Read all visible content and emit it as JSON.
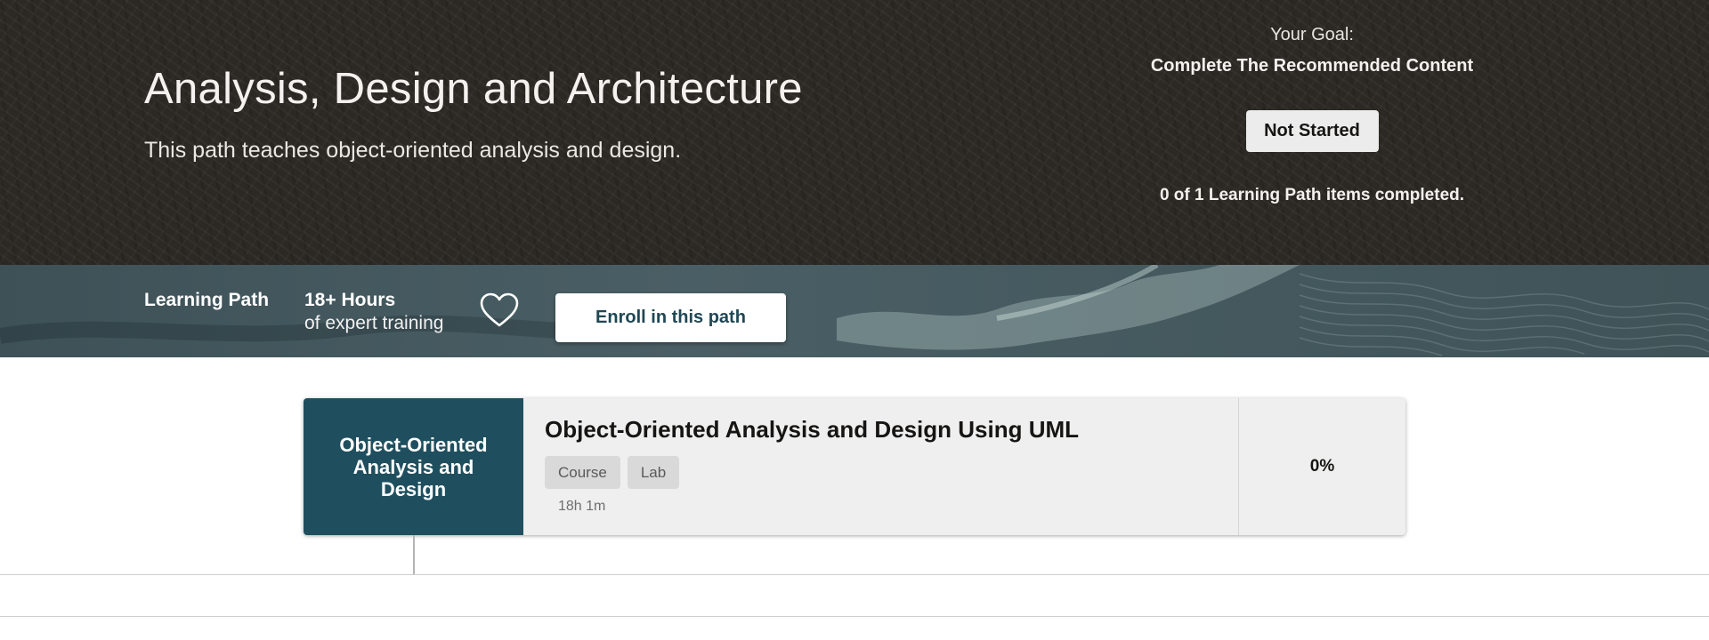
{
  "hero": {
    "title": "Analysis, Design and Architecture",
    "subtitle": "This path teaches object-oriented analysis and design."
  },
  "goal": {
    "label": "Your Goal:",
    "text": "Complete The Recommended Content",
    "status_button": "Not Started",
    "progress_text": "0 of 1 Learning Path items completed."
  },
  "band": {
    "type_label": "Learning Path",
    "hours": "18+ Hours",
    "hours_sub": "of expert training",
    "favorite_icon": "heart-outline-icon",
    "enroll_button": "Enroll in this path"
  },
  "path_items": [
    {
      "tile_label": "Object-Oriented Analysis and Design",
      "title": "Object-Oriented Analysis and Design Using UML",
      "tags": [
        "Course",
        "Lab"
      ],
      "duration": "18h 1m",
      "progress": "0%"
    }
  ],
  "colors": {
    "hero_bg": "#2c2824",
    "band_bg": "#44585e",
    "tile_bg": "#1f4f5e",
    "enroll_text": "#1f4754",
    "card_bg": "#efefef"
  }
}
